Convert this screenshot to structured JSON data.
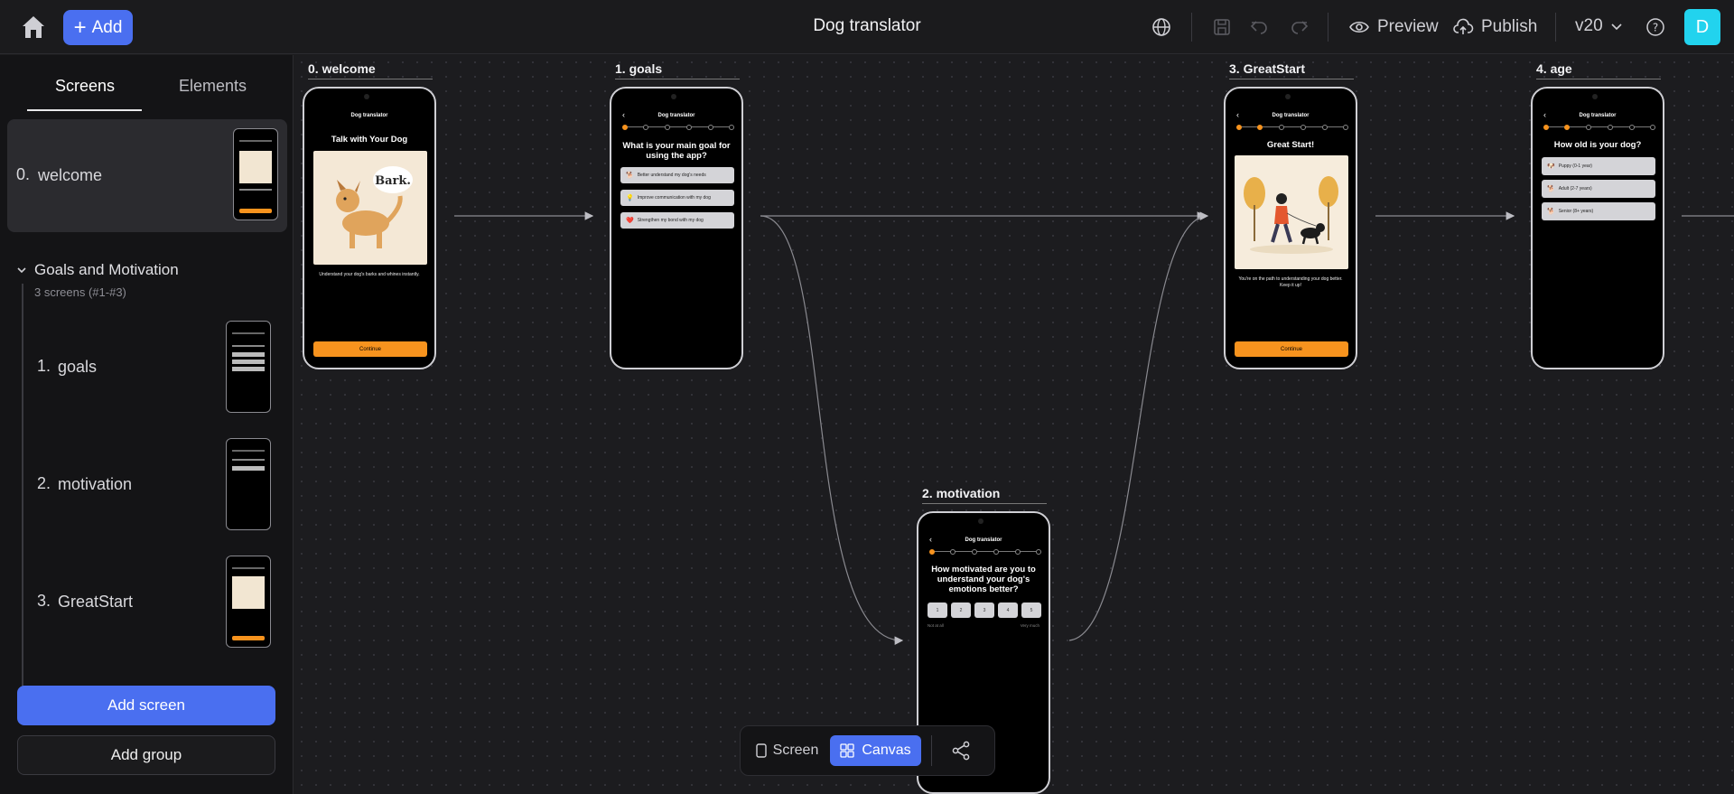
{
  "header": {
    "add_label": "Add",
    "title": "Dog translator",
    "preview_label": "Preview",
    "publish_label": "Publish",
    "version": "v20",
    "avatar_letter": "D"
  },
  "sidebar": {
    "tabs": [
      "Screens",
      "Elements"
    ],
    "selected_screen": {
      "num": "0.",
      "name": "welcome"
    },
    "group": {
      "title": "Goals and Motivation",
      "subtitle": "3 screens (#1-#3)"
    },
    "group_screens": [
      {
        "num": "1.",
        "name": "goals"
      },
      {
        "num": "2.",
        "name": "motivation"
      },
      {
        "num": "3.",
        "name": "GreatStart"
      }
    ],
    "add_screen_label": "Add screen",
    "add_group_label": "Add group"
  },
  "canvas": {
    "frames": {
      "welcome": {
        "label": "0. welcome",
        "app_name": "Dog translator",
        "title": "Talk with Your Dog",
        "bubble": "Bark.",
        "caption": "Understand your dog's barks and whines instantly.",
        "button": "Continue"
      },
      "goals": {
        "label": "1. goals",
        "app_name": "Dog translator",
        "title": "What is your main goal for using the app?",
        "options": [
          {
            "icon": "🐕",
            "text": "Better understand my dog's needs"
          },
          {
            "icon": "💡",
            "text": "Improve communication with my dog"
          },
          {
            "icon": "❤️",
            "text": "Strengthen my bond with my dog"
          }
        ],
        "progress": 1
      },
      "motivation": {
        "label": "2. motivation",
        "app_name": "Dog translator",
        "title": "How motivated are you to understand your dog's emotions better?",
        "scale": [
          "1",
          "2",
          "3",
          "4",
          "5"
        ],
        "scale_low": "Not at all",
        "scale_high": "Very much",
        "progress": 1
      },
      "greatstart": {
        "label": "3. GreatStart",
        "app_name": "Dog translator",
        "title": "Great Start!",
        "caption": "You're on the path to understanding your dog better. Keep it up!",
        "button": "Continue",
        "progress": 2
      },
      "age": {
        "label": "4. age",
        "app_name": "Dog translator",
        "title": "How old is your dog?",
        "options": [
          {
            "icon": "🐶",
            "text": "Puppy (0-1 year)"
          },
          {
            "icon": "🐕",
            "text": "Adult (2-7 years)"
          },
          {
            "icon": "🐕",
            "text": "Senior (8+ years)"
          }
        ],
        "progress": 2
      }
    },
    "view_toggle": {
      "screen_label": "Screen",
      "canvas_label": "Canvas",
      "active": "Canvas"
    }
  },
  "colors": {
    "accent": "#4a6ff0",
    "brand_orange": "#f7931e",
    "avatar": "#22d3ee"
  }
}
